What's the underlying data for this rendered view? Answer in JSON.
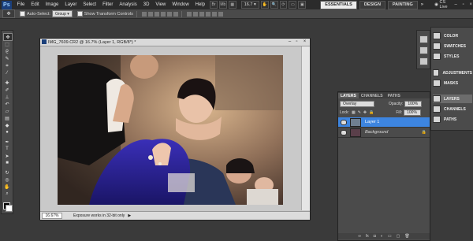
{
  "menu": {
    "logo": "Ps",
    "items": [
      "File",
      "Edit",
      "Image",
      "Layer",
      "Select",
      "Filter",
      "Analysis",
      "3D",
      "View",
      "Window",
      "Help"
    ],
    "zoom": "16.7",
    "workspaces": [
      "ESSENTIALS",
      "DESIGN",
      "PAINTING"
    ],
    "active_workspace": "ESSENTIALS",
    "more": "»",
    "cs_live": "CS Live"
  },
  "options_bar": {
    "auto_select_label": "Auto-Select:",
    "auto_select_value": "Group",
    "show_transform_label": "Show Transform Controls"
  },
  "document": {
    "title": "IMG_7609.CR2 @ 16.7% (Layer 1, RGB/8*) *",
    "status_zoom": "16.67%",
    "status_info": "Exposure works in 32-bit only"
  },
  "dock_panels": [
    {
      "label": "COLOR",
      "icon": "color-icon"
    },
    {
      "label": "SWATCHES",
      "icon": "swatches-icon"
    },
    {
      "label": "STYLES",
      "icon": "styles-icon"
    },
    {
      "label": "ADJUSTMENTS",
      "icon": "adjustments-icon"
    },
    {
      "label": "MASKS",
      "icon": "masks-icon"
    },
    {
      "label": "LAYERS",
      "icon": "layers-icon"
    },
    {
      "label": "CHANNELS",
      "icon": "channels-icon"
    },
    {
      "label": "PATHS",
      "icon": "paths-icon"
    }
  ],
  "layers_panel": {
    "tabs": [
      "LAYERS",
      "CHANNELS",
      "PATHS"
    ],
    "blend_mode": "Overlay",
    "opacity_label": "Opacity:",
    "opacity": "100%",
    "lock_label": "Lock:",
    "fill_label": "Fill:",
    "fill": "100%",
    "layers": [
      {
        "name": "Layer 1",
        "selected": true
      },
      {
        "name": "Background",
        "selected": false
      }
    ]
  },
  "colors": {
    "selection": "#3d85e0",
    "canvas_border": "#c9c9c9"
  }
}
